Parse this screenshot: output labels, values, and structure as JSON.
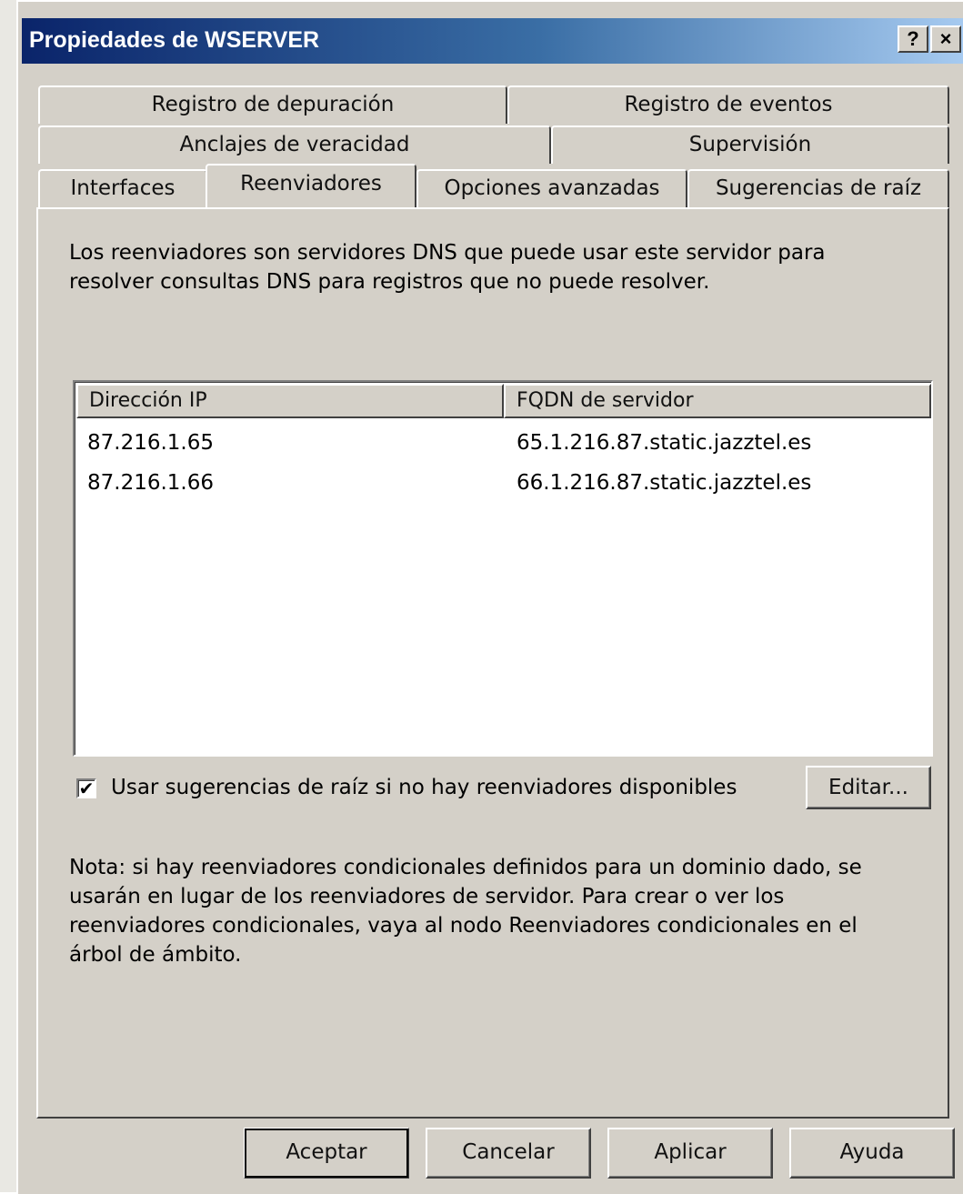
{
  "window": {
    "title": "Propiedades de WSERVER",
    "help_glyph": "?",
    "close_glyph": "×"
  },
  "tabs": {
    "row1": [
      "Registro de depuración",
      "Registro de eventos"
    ],
    "row2": [
      "Anclajes de veracidad",
      "Supervisión"
    ],
    "row3": [
      "Interfaces",
      "Reenviadores",
      "Opciones avanzadas",
      "Sugerencias de raíz"
    ],
    "active": "Reenviadores"
  },
  "panel": {
    "description": "Los reenviadores son servidores DNS que puede usar este servidor para resolver consultas DNS para registros que no puede resolver.",
    "list": {
      "columns": [
        "Dirección IP",
        "FQDN de servidor"
      ],
      "rows": [
        [
          "87.216.1.65",
          "65.1.216.87.static.jazztel.es"
        ],
        [
          "87.216.1.66",
          "66.1.216.87.static.jazztel.es"
        ]
      ]
    },
    "root_hints_checkbox": {
      "label": "Usar sugerencias de raíz si no hay reenviadores disponibles",
      "checked": true,
      "check_glyph": "✔"
    },
    "edit_button": "Editar...",
    "note": "Nota: si hay reenviadores condicionales definidos para un dominio dado, se usarán en lugar de los reenviadores de servidor. Para crear o ver los reenviadores condicionales, vaya al nodo Reenviadores condicionales en el árbol de ámbito."
  },
  "buttons": {
    "ok": "Aceptar",
    "cancel": "Cancelar",
    "apply": "Aplicar",
    "help": "Ayuda"
  },
  "colors": {
    "dialog_bg": "#d4d0c8",
    "title_gradient_start": "#0a246a",
    "title_gradient_end": "#a6caf0"
  }
}
